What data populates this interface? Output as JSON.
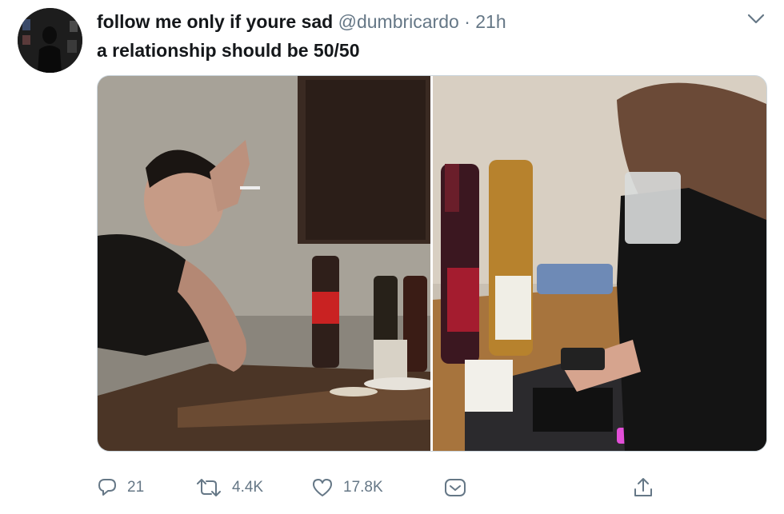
{
  "tweet": {
    "author_name": "follow me only if youre sad",
    "handle": "@dumbricardo",
    "separator": "·",
    "time": "21h",
    "text": "a relationship should be 50/50",
    "avatar_icon": "profile-avatar",
    "menu_icon": "chevron-down-icon",
    "media": {
      "left_image": "man crying at table with cigarette",
      "right_image": "woman crying with glass and phone"
    },
    "actions": {
      "reply": {
        "count": "21",
        "icon": "reply-icon"
      },
      "retweet": {
        "count": "4.4K",
        "icon": "retweet-icon"
      },
      "like": {
        "count": "17.8K",
        "icon": "heart-icon"
      },
      "dm": {
        "icon": "direct-message-icon"
      },
      "share": {
        "icon": "share-icon"
      }
    }
  },
  "colors": {
    "text_primary": "#14171a",
    "text_secondary": "#657786",
    "border": "#ccd6dd"
  }
}
